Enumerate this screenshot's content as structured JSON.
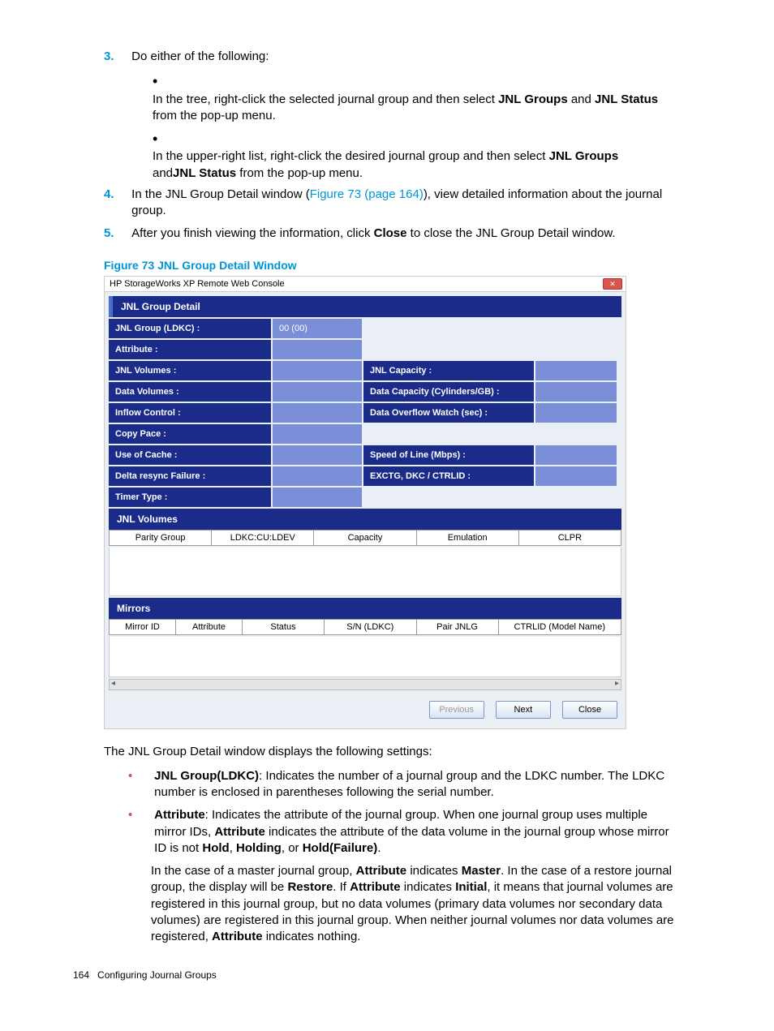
{
  "steps": {
    "n3": "3.",
    "s3": "Do either of the following:",
    "s3a_pre": "In the tree, right-click the selected journal group and then select ",
    "s3a_b1": "JNL Groups",
    "s3a_mid": " and ",
    "s3a_b2": "JNL Status",
    "s3a_post": " from the pop-up menu.",
    "s3b_pre": "In the upper-right list, right-click the desired journal group and then select ",
    "s3b_b1": "JNL Groups",
    "s3b_mid": " and",
    "s3b_b2": "JNL Status",
    "s3b_post": " from the pop-up menu.",
    "n4": "4.",
    "s4_pre": "In the JNL Group Detail window (",
    "s4_link": "Figure 73 (page 164)",
    "s4_post": "), view detailed information about the journal group.",
    "n5": "5.",
    "s5_pre": "After you finish viewing the information, click ",
    "s5_b1": "Close",
    "s5_post": " to close the JNL Group Detail window."
  },
  "figure": {
    "caption": "Figure 73 JNL Group Detail Window",
    "title": "HP StorageWorks XP Remote Web Console",
    "panel": "JNL Group Detail",
    "labels": {
      "jnl_group": "JNL Group (LDKC) :",
      "jnl_group_val": "00 (00)",
      "attribute": "Attribute :",
      "jnl_vol": "JNL Volumes :",
      "jnl_cap": "JNL Capacity :",
      "data_vol": "Data Volumes :",
      "data_cap": "Data Capacity (Cylinders/GB) :",
      "inflow": "Inflow Control :",
      "overflow": "Data Overflow Watch (sec) :",
      "copy": "Copy Pace :",
      "cache": "Use of Cache :",
      "speed": "Speed of Line (Mbps) :",
      "delta": "Delta resync Failure :",
      "exctg": "EXCTG, DKC / CTRLID :",
      "timer": "Timer Type :"
    },
    "sections": {
      "jnlvol": "JNL Volumes",
      "mirrors": "Mirrors"
    },
    "cols1": {
      "c1": "Parity Group",
      "c2": "LDKC:CU:LDEV",
      "c3": "Capacity",
      "c4": "Emulation",
      "c5": "CLPR"
    },
    "cols2": {
      "c1": "Mirror ID",
      "c2": "Attribute",
      "c3": "Status",
      "c4": "S/N (LDKC)",
      "c5": "Pair JNLG",
      "c6": "CTRLID (Model Name)"
    },
    "buttons": {
      "prev": "Previous",
      "next": "Next",
      "close": "Close"
    }
  },
  "intro": "The JNL Group Detail window displays the following settings:",
  "desc": {
    "i1_b": "JNL Group(LDKC)",
    "i1_t": ": Indicates the number of a journal group and the LDKC number. The LDKC number is enclosed in parentheses following the serial number.",
    "i2_b1": "Attribute",
    "i2_t1": ": Indicates the attribute of the journal group. When one journal group uses multiple mirror IDs, ",
    "i2_b2": "Attribute",
    "i2_t2": " indicates the attribute of the data volume in the journal group whose mirror ID is not ",
    "i2_b3": "Hold",
    "i2_t3": ", ",
    "i2_b4": "Holding",
    "i2_t4": ", or ",
    "i2_b5": "Hold(Failure)",
    "i2_t5": ".",
    "i2c_t1": "In the case of a master journal group, ",
    "i2c_b1": "Attribute",
    "i2c_t2": " indicates ",
    "i2c_b2": "Master",
    "i2c_t3": ". In the case of a restore journal group, the display will be ",
    "i2c_b3": "Restore",
    "i2c_t4": ". If ",
    "i2c_b4": "Attribute",
    "i2c_t5": " indicates ",
    "i2c_b5": "Initial",
    "i2c_t6": ", it means that journal volumes are registered in this journal group, but no data volumes (primary data volumes nor secondary data volumes) are registered in this journal group. When neither journal volumes nor data volumes are registered, ",
    "i2c_b6": "Attribute",
    "i2c_t7": " indicates nothing."
  },
  "footer": {
    "page": "164",
    "section": "Configuring Journal Groups"
  }
}
